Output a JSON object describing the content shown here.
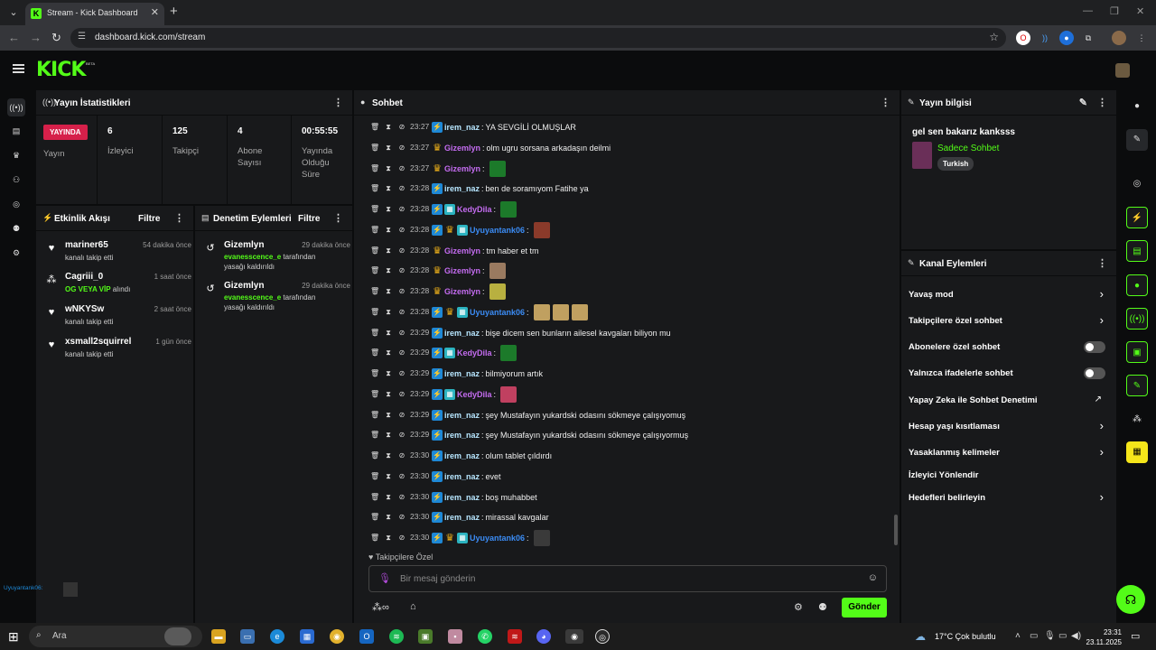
{
  "browser": {
    "tab_title": "Stream - Kick Dashboard",
    "url": "dashboard.kick.com/stream"
  },
  "header": {
    "logo": "KICK",
    "beta": "BETA"
  },
  "stats_panel": {
    "title": "Yayın İstatistikleri",
    "status_badge": "YAYINDA",
    "status_label": "Yayın",
    "viewers_value": "6",
    "viewers_label": "İzleyici",
    "followers_value": "125",
    "followers_label": "Takipçi",
    "subs_value": "4",
    "subs_label": "Abone Sayısı",
    "duration_value": "00:55:55",
    "duration_label": "Yayında Olduğu Süre"
  },
  "activity_panel": {
    "title": "Etkinlik Akışı",
    "filter": "Filtre",
    "items": [
      {
        "user": "mariner65",
        "sub": "kanalı takip etti",
        "time": "54 dakika önce",
        "icon": "heart-icon"
      },
      {
        "user": "Cagriii_0",
        "sub_green": "OG VEYA VİP",
        "sub": "alındı",
        "time": "1 saat önce",
        "icon": "coins-icon"
      },
      {
        "user": "wNKYSw",
        "sub": "kanalı takip etti",
        "time": "2 saat önce",
        "icon": "heart-icon"
      },
      {
        "user": "xsmall2squirrel",
        "sub": "kanalı takip etti",
        "time": "1 gün önce",
        "icon": "heart-icon"
      }
    ]
  },
  "moderation_panel": {
    "title": "Denetim Eylemleri",
    "filter": "Filtre",
    "items": [
      {
        "user": "Gizemlyn",
        "time": "29 dakika önce",
        "target": "evanesscence_e",
        "line1": "tarafından",
        "line2": "yasağı kaldırıldı"
      },
      {
        "user": "Gizemlyn",
        "time": "29 dakika önce",
        "target": "evanesscence_e",
        "line1": "tarafından",
        "line2": "yasağı kaldırıldı"
      }
    ]
  },
  "chat": {
    "title": "Sohbet",
    "follow_only_label": "Takipçilere Özel",
    "input_placeholder": "Bir mesaj gönderin",
    "send_label": "Gönder",
    "messages": [
      {
        "time": "23:27",
        "user": "irem_naz",
        "color": "#b7e6ff",
        "badges": [
          "vip"
        ],
        "text": "YA SEVGİLİ OLMUŞLAR",
        "emotes": []
      },
      {
        "time": "23:27",
        "user": "Gizemlyn",
        "color": "#c46cf0",
        "badges": [
          "crown"
        ],
        "text": "olm ugru sorsana arkadaşın deilmi",
        "emotes": []
      },
      {
        "time": "23:27",
        "user": "Gizemlyn",
        "color": "#c46cf0",
        "badges": [
          "crown"
        ],
        "text": "",
        "emotes": [
          "#1c7a2a"
        ]
      },
      {
        "time": "23:28",
        "user": "irem_naz",
        "color": "#b7e6ff",
        "badges": [
          "vip"
        ],
        "text": "ben de soramıyom Fatihe ya",
        "emotes": []
      },
      {
        "time": "23:28",
        "user": "KedyDila",
        "color": "#c46cf0",
        "badges": [
          "vip",
          "sub"
        ],
        "text": "",
        "emotes": [
          "#1c7a2a"
        ]
      },
      {
        "time": "23:28",
        "user": "Uyuyantank06",
        "color": "#3b8cf5",
        "badges": [
          "vip",
          "crown",
          "sub"
        ],
        "text": "",
        "emotes": [
          "#8a3a2a"
        ]
      },
      {
        "time": "23:28",
        "user": "Gizemlyn",
        "color": "#c46cf0",
        "badges": [
          "crown"
        ],
        "text": "tm haber et tm",
        "emotes": []
      },
      {
        "time": "23:28",
        "user": "Gizemlyn",
        "color": "#c46cf0",
        "badges": [
          "crown"
        ],
        "text": "",
        "emotes": [
          "#9a7a60"
        ]
      },
      {
        "time": "23:28",
        "user": "Gizemlyn",
        "color": "#c46cf0",
        "badges": [
          "crown"
        ],
        "text": "",
        "emotes": [
          "#b8b040"
        ]
      },
      {
        "time": "23:28",
        "user": "Uyuyantank06",
        "color": "#3b8cf5",
        "badges": [
          "vip",
          "crown",
          "sub"
        ],
        "text": "",
        "emotes": [
          "#c0a060",
          "#c0a060",
          "#c0a060"
        ]
      },
      {
        "time": "23:29",
        "user": "irem_naz",
        "color": "#b7e6ff",
        "badges": [
          "vip"
        ],
        "text": "bişe dicem sen bunların ailesel kavgaları biliyon mu",
        "emotes": []
      },
      {
        "time": "23:29",
        "user": "KedyDila",
        "color": "#c46cf0",
        "badges": [
          "vip",
          "sub"
        ],
        "text": "",
        "emotes": [
          "#1c7a2a"
        ]
      },
      {
        "time": "23:29",
        "user": "irem_naz",
        "color": "#b7e6ff",
        "badges": [
          "vip"
        ],
        "text": "bilmiyorum artık",
        "emotes": []
      },
      {
        "time": "23:29",
        "user": "KedyDila",
        "color": "#c46cf0",
        "badges": [
          "vip",
          "sub"
        ],
        "text": "",
        "emotes": [
          "#c04060"
        ]
      },
      {
        "time": "23:29",
        "user": "irem_naz",
        "color": "#b7e6ff",
        "badges": [
          "vip"
        ],
        "text": "şey Mustafayın yukardski odasını sökmeye çalışıyomuş",
        "emotes": []
      },
      {
        "time": "23:29",
        "user": "irem_naz",
        "color": "#b7e6ff",
        "badges": [
          "vip"
        ],
        "text": "şey Mustafayın yukardski odasını sökmeye çalışıyormuş",
        "emotes": []
      },
      {
        "time": "23:30",
        "user": "irem_naz",
        "color": "#b7e6ff",
        "badges": [
          "vip"
        ],
        "text": "olum tablet çıldırdı",
        "emotes": []
      },
      {
        "time": "23:30",
        "user": "irem_naz",
        "color": "#b7e6ff",
        "badges": [
          "vip"
        ],
        "text": "evet",
        "emotes": []
      },
      {
        "time": "23:30",
        "user": "irem_naz",
        "color": "#b7e6ff",
        "badges": [
          "vip"
        ],
        "text": "boş muhabbet",
        "emotes": []
      },
      {
        "time": "23:30",
        "user": "irem_naz",
        "color": "#b7e6ff",
        "badges": [
          "vip"
        ],
        "text": "mirassal kavgalar",
        "emotes": []
      },
      {
        "time": "23:30",
        "user": "Uyuyantank06",
        "color": "#3b8cf5",
        "badges": [
          "vip",
          "crown",
          "sub"
        ],
        "text": "",
        "emotes": [
          "#3a3a3a"
        ]
      }
    ]
  },
  "stream_info": {
    "title": "Yayın bilgisi",
    "stream_title": "gel sen bakarız kanksss",
    "category": "Sadece Sohbet",
    "language": "Turkish"
  },
  "channel_actions": {
    "title": "Kanal Eylemleri",
    "items": [
      {
        "label": "Yavaş mod",
        "control": "chevron"
      },
      {
        "label": "Takipçilere özel sohbet",
        "control": "chevron"
      },
      {
        "label": "Abonelere özel sohbet",
        "control": "toggle"
      },
      {
        "label": "Yalnızca ifadelerle sohbet",
        "control": "toggle"
      },
      {
        "label": "Yapay Zeka ile Sohbet Denetimi",
        "control": "external"
      },
      {
        "label": "Hesap yaşı kısıtlaması",
        "control": "chevron"
      },
      {
        "label": "Yasaklanmış kelimeler",
        "control": "chevron"
      },
      {
        "label": "İzleyici Yönlendir",
        "control": "none"
      },
      {
        "label": "Hedefleri belirleyin",
        "control": "chevron"
      }
    ]
  },
  "mini_chat": {
    "user": "Uyuyantank06",
    "sep": ":"
  },
  "taskbar": {
    "search_placeholder": "Ara",
    "weather": "17°C  Çok bulutlu",
    "time": "23:31",
    "date": "23.11.2025"
  },
  "colors": {
    "accent": "#53fc18",
    "live": "#d6204a"
  }
}
